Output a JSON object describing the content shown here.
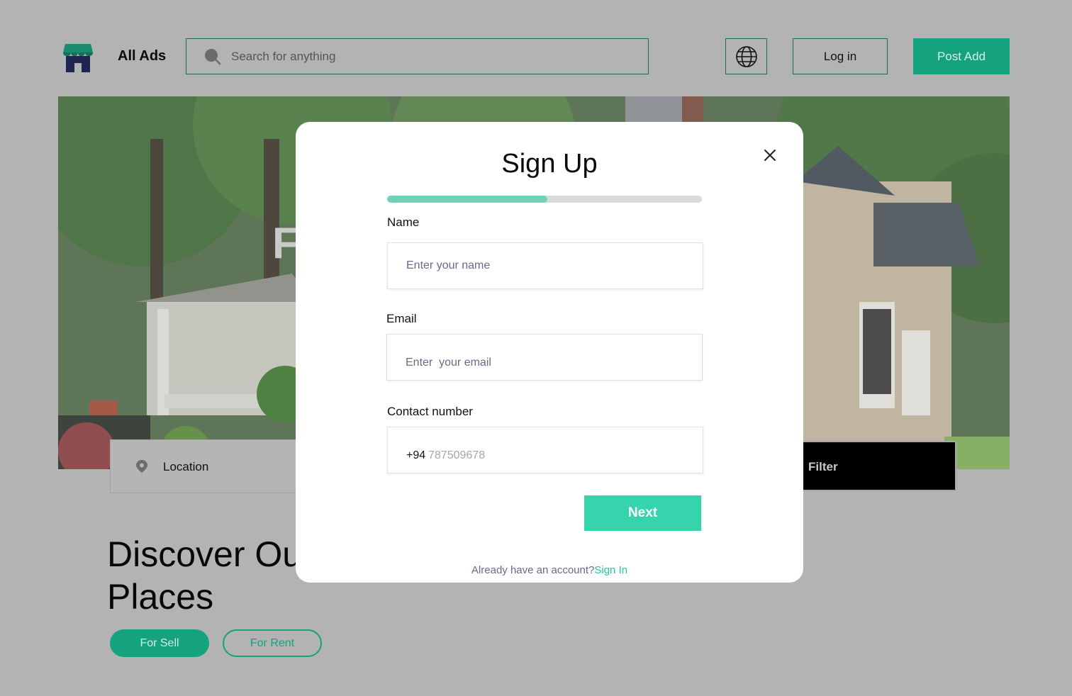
{
  "header": {
    "brand": "All Ads",
    "search_placeholder": "Search for anything",
    "login_label": "Log in",
    "post_label": "Post Add"
  },
  "hero": {
    "partial_heading": "F",
    "location_label": "Location",
    "filter_label": "Filter"
  },
  "discover": {
    "heading_line1": "Discover Ou",
    "heading_line2": "Places",
    "sell_label": "For Sell",
    "rent_label": "For Rent"
  },
  "modal": {
    "title": "Sign Up",
    "progress": 0.51,
    "name_label": "Name",
    "name_placeholder": "Enter your name",
    "email_label": "Email",
    "email_placeholder": "Enter  your email",
    "contact_label": "Contact number",
    "phone_prefix": "+94",
    "phone_placeholder": "787509678",
    "next_label": "Next",
    "have_account_text": "Already have an account?",
    "signin_label": "Sign In"
  },
  "colors": {
    "accent": "#14a27f",
    "next_button": "#36d4ad",
    "progress_fill": "#6fd2b4",
    "overlay_bg": "#b3b3b3"
  }
}
